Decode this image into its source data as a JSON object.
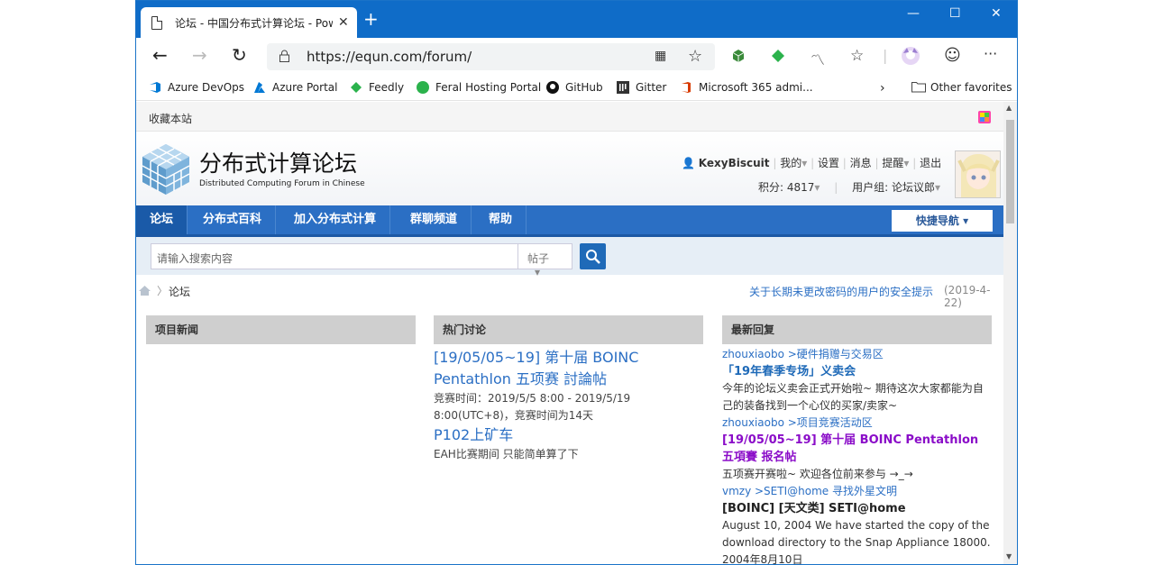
{
  "browser": {
    "tab_title": "论坛 - 中国分布式计算论坛 - Pow",
    "url": "https://equn.com/forum/"
  },
  "bookmarks": [
    {
      "label": "Azure DevOps",
      "icon": "azure-devops-icon",
      "color": "#0078d4"
    },
    {
      "label": "Azure Portal",
      "icon": "azure-icon",
      "color": "#0078d4"
    },
    {
      "label": "Feedly",
      "icon": "feedly-icon",
      "color": "#2bb24c"
    },
    {
      "label": "Feral Hosting Portal",
      "icon": "feral-icon",
      "color": "#2bb24c"
    },
    {
      "label": "GitHub",
      "icon": "github-icon",
      "color": "#111111"
    },
    {
      "label": "Gitter",
      "icon": "gitter-icon",
      "color": "#333333"
    },
    {
      "label": "Microsoft 365 admi...",
      "icon": "office-icon",
      "color": "#d83b01"
    }
  ],
  "other_favorites": "Other favorites",
  "site": {
    "favorites_link": "收藏本站",
    "title": "分布式计算论坛",
    "subtitle": "Distributed Computing Forum in Chinese",
    "username": "KexyBiscuit",
    "menu": [
      "我的",
      "设置",
      "消息",
      "提醒",
      "退出"
    ],
    "points": "积分: 4817",
    "usergroup": "用户组: 论坛议郎"
  },
  "nav": {
    "items": [
      "论坛",
      "分布式百科",
      "加入分布式计算",
      "群聊频道",
      "帮助"
    ],
    "quick_nav": "快捷导航"
  },
  "search": {
    "placeholder": "请输入搜索内容",
    "type": "帖子"
  },
  "breadcrumb": {
    "current": "论坛",
    "notice": "关于长期未更改密码的用户的安全提示",
    "notice_date": "(2019-4-22)"
  },
  "columns": {
    "news": {
      "heading": "项目新闻"
    },
    "hot": {
      "heading": "热门讨论",
      "items": [
        {
          "title": "[19/05/05~19] 第十届 BOINC Pentathlon 五项赛 討論帖",
          "desc": "竞赛时间：2019/5/5 8:00 - 2019/5/19 8:00(UTC+8)，竞赛时间为14天"
        },
        {
          "title": "P102上矿车",
          "desc": "EAH比赛期间 只能简单算了下"
        }
      ]
    },
    "replies": {
      "heading": "最新回复",
      "items": [
        {
          "meta": "zhouxiaobo >硬件捐赠与交易区",
          "title": "「19年春季专场」义卖会",
          "body": "今年的论坛义卖会正式开始啦~ 期待这次大家都能为自己的装备找到一个心仪的买家/卖家~"
        },
        {
          "meta": "zhouxiaobo >项目竞赛活动区",
          "title": "[19/05/05~19] 第十届 BOINC Pentathlon 五項賽 报名帖",
          "body": "五项赛开赛啦~ 欢迎各位前来参与 →_→"
        },
        {
          "meta": "vmzy >SETI@home 寻找外星文明",
          "title": "[BOINC] [天文类] SETI@home",
          "body": "August 10, 2004 We have started the copy of the download directory to the Snap Appliance 18000. 2004年8月10日"
        }
      ]
    }
  }
}
